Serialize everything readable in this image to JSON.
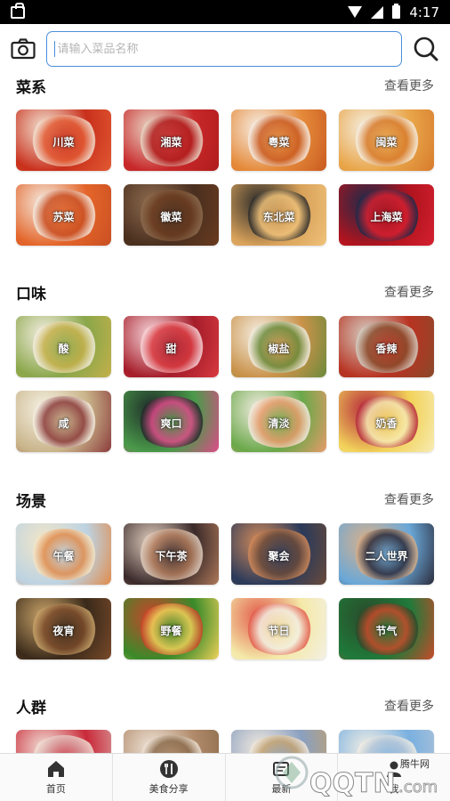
{
  "status_bar": {
    "time": "4:17"
  },
  "search": {
    "placeholder": "请输入菜品名称"
  },
  "sections": [
    {
      "title": "菜系",
      "more": "查看更多",
      "items": [
        {
          "label": "川菜",
          "colors": [
            "#c9301c",
            "#f2e3d3",
            "#e25a33"
          ]
        },
        {
          "label": "湘菜",
          "colors": [
            "#c8282a",
            "#e9d9c8",
            "#b01c1c"
          ]
        },
        {
          "label": "粤菜",
          "colors": [
            "#e58a3a",
            "#f6efe6",
            "#c95a20"
          ]
        },
        {
          "label": "闽菜",
          "colors": [
            "#e9a64a",
            "#f5f0e4",
            "#d77a2a"
          ]
        },
        {
          "label": "苏菜",
          "colors": [
            "#e4652a",
            "#f4ece2",
            "#c94f22"
          ]
        },
        {
          "label": "徽菜",
          "colors": [
            "#4a2f1f",
            "#8d6b4e",
            "#6a3b1f"
          ]
        },
        {
          "label": "东北菜",
          "colors": [
            "#d9a25a",
            "#2a2a2a",
            "#f0c27a"
          ]
        },
        {
          "label": "上海菜",
          "colors": [
            "#b0141e",
            "#1c2a4a",
            "#d62030"
          ]
        }
      ]
    },
    {
      "title": "口味",
      "more": "查看更多",
      "items": [
        {
          "label": "酸",
          "colors": [
            "#8aa74a",
            "#f4eee2",
            "#c5b04a"
          ]
        },
        {
          "label": "甜",
          "colors": [
            "#a51d2a",
            "#f7d8dc",
            "#d93a40"
          ]
        },
        {
          "label": "椒盐",
          "colors": [
            "#c9924a",
            "#f6efe4",
            "#6a8a3a"
          ]
        },
        {
          "label": "香辣",
          "colors": [
            "#b83322",
            "#d5cfc4",
            "#8a4a2a"
          ]
        },
        {
          "label": "咸",
          "colors": [
            "#c9b48a",
            "#f6f2e4",
            "#8a3a3a"
          ]
        },
        {
          "label": "爽口",
          "colors": [
            "#4a9a4a",
            "#1e2a28",
            "#e04a8a"
          ]
        },
        {
          "label": "清淡",
          "colors": [
            "#6aa84a",
            "#f3ede2",
            "#e89a6a"
          ]
        },
        {
          "label": "奶香",
          "colors": [
            "#f2d25a",
            "#b5263a",
            "#f7ecb4"
          ]
        }
      ]
    },
    {
      "title": "场景",
      "more": "查看更多",
      "items": [
        {
          "label": "午餐",
          "colors": [
            "#bdd3e2",
            "#f3e6c8",
            "#e08a4a"
          ]
        },
        {
          "label": "下午茶",
          "colors": [
            "#3a2a2a",
            "#e2cfc0",
            "#b07a5a"
          ]
        },
        {
          "label": "聚会",
          "colors": [
            "#2a3a5a",
            "#d28a5a",
            "#6a4a3a"
          ]
        },
        {
          "label": "二人世界",
          "colors": [
            "#6aa8d8",
            "#d9b08a",
            "#2a2a3a"
          ]
        },
        {
          "label": "夜宵",
          "colors": [
            "#3a2a1a",
            "#c9a46a",
            "#7a4a2a"
          ]
        },
        {
          "label": "野餐",
          "colors": [
            "#3a8a2a",
            "#c9442a",
            "#f0d25a"
          ]
        },
        {
          "label": "节日",
          "colors": [
            "#f4e9a8",
            "#e25a4a",
            "#f3f0e4"
          ]
        },
        {
          "label": "节气",
          "colors": [
            "#1f7a3a",
            "#2a4a2a",
            "#c94a2a"
          ]
        }
      ]
    },
    {
      "title": "人群",
      "more": "查看更多",
      "items": [
        {
          "label": "",
          "colors": [
            "#c92a3a",
            "#f2e2d8",
            "#d9a0a0"
          ]
        },
        {
          "label": "",
          "colors": [
            "#b08a6a",
            "#f0e4d8",
            "#8a6a4a"
          ]
        },
        {
          "label": "",
          "colors": [
            "#8aa0c0",
            "#f1e9de",
            "#c0a070"
          ]
        },
        {
          "label": "",
          "colors": [
            "#7ab0e0",
            "#f2eee4",
            "#b0c4d8"
          ]
        }
      ]
    }
  ],
  "tabs": [
    {
      "label": "首页",
      "icon": "home-icon"
    },
    {
      "label": "美食分享",
      "icon": "utensils-icon"
    },
    {
      "label": "最新",
      "icon": "new-icon"
    },
    {
      "label": "我",
      "icon": "person-icon"
    }
  ],
  "watermark": {
    "site": "腾牛网",
    "brand": "QQTN",
    "domain": ".com"
  },
  "colors": {
    "accent": "#4a8fdd",
    "text": "#111111",
    "muted": "#555555"
  }
}
